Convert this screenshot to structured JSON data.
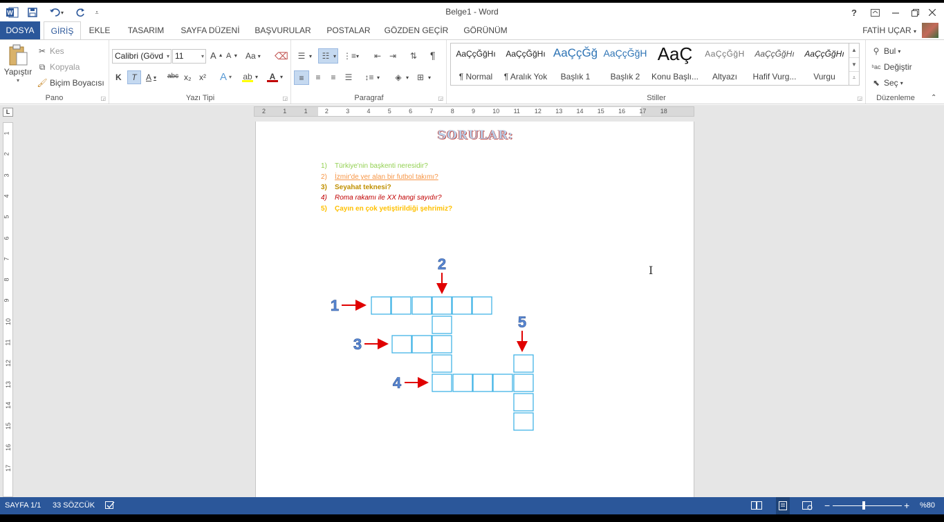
{
  "window": {
    "title": "Belge1 - Word",
    "help": "?",
    "user": "FATİH UÇAR"
  },
  "tabs": [
    "DOSYA",
    "GİRİŞ",
    "EKLE",
    "TASARIM",
    "SAYFA DÜZENİ",
    "BAŞVURULAR",
    "POSTALAR",
    "GÖZDEN GEÇİR",
    "GÖRÜNÜM"
  ],
  "ribbon": {
    "clipboard": {
      "paste": "Yapıştır",
      "cut": "Kes",
      "copy": "Kopyala",
      "format_painter": "Biçim Boyacısı",
      "label": "Pano"
    },
    "font": {
      "family": "Calibri (Gövd",
      "size": "11",
      "change_case": "Aa",
      "bold": "K",
      "italic": "T",
      "underline": "A",
      "strike": "abc",
      "sub": "x₂",
      "sup": "x²",
      "label": "Yazı Tipi"
    },
    "paragraph": {
      "label": "Paragraf"
    },
    "styles": {
      "label": "Stiller",
      "items": [
        {
          "preview": "AaÇçĞğHı",
          "name": "¶ Normal",
          "color": "#222"
        },
        {
          "preview": "AaÇçĞğHı",
          "name": "¶ Aralık Yok",
          "color": "#222"
        },
        {
          "preview": "AaÇçĞğ",
          "name": "Başlık 1",
          "color": "#2e74b5"
        },
        {
          "preview": "AaÇçĞğH",
          "name": "Başlık 2",
          "color": "#2e74b5"
        },
        {
          "preview": "AaÇ",
          "name": "Konu Başlı...",
          "color": "#111"
        },
        {
          "preview": "AaÇçĞğH",
          "name": "Altyazı",
          "color": "#666"
        },
        {
          "preview": "AaÇçĞğHı",
          "name": "Hafif Vurg...",
          "color": "#444"
        },
        {
          "preview": "AaÇçĞğHı",
          "name": "Vurgu",
          "color": "#222"
        }
      ]
    },
    "editing": {
      "find": "Bul",
      "replace": "Değiştir",
      "select": "Seç",
      "label": "Düzenleme"
    }
  },
  "ruler": {
    "h": [
      "2",
      "1",
      "1",
      "2",
      "3",
      "4",
      "5",
      "6",
      "7",
      "8",
      "9",
      "10",
      "11",
      "12",
      "13",
      "14",
      "15",
      "16",
      "17",
      "18"
    ],
    "v": [
      "1",
      "2",
      "3",
      "4",
      "5",
      "6",
      "7",
      "8",
      "9",
      "10",
      "11",
      "12",
      "13",
      "14",
      "15",
      "16",
      "17"
    ]
  },
  "document": {
    "heading": "SORULAR:",
    "questions": [
      {
        "num": "1)",
        "text": "Türkiye'nin başkenti neresidir?",
        "color": "#92d050",
        "style": "normal"
      },
      {
        "num": "2)",
        "text": "İzmir'de yer alan bir futbol takımı?",
        "color": "#f79646",
        "style": "underline"
      },
      {
        "num": "3)",
        "text": "Seyahat teknesi?",
        "color": "#c09000",
        "style": "bold"
      },
      {
        "num": "4)",
        "text": "Roma rakamı ile XX hangi sayıdır?",
        "color": "#c00000",
        "style": "italic"
      },
      {
        "num": "5)",
        "text": "Çayın en çok yetiştirildiği şehrimiz?",
        "color": "#ffc000",
        "style": "bold"
      }
    ],
    "crossword_labels": [
      "1",
      "2",
      "3",
      "4",
      "5"
    ]
  },
  "status": {
    "page": "SAYFA 1/1",
    "words": "33 SÖZCÜK",
    "zoom": "%80",
    "zoom_level": 0.45
  }
}
